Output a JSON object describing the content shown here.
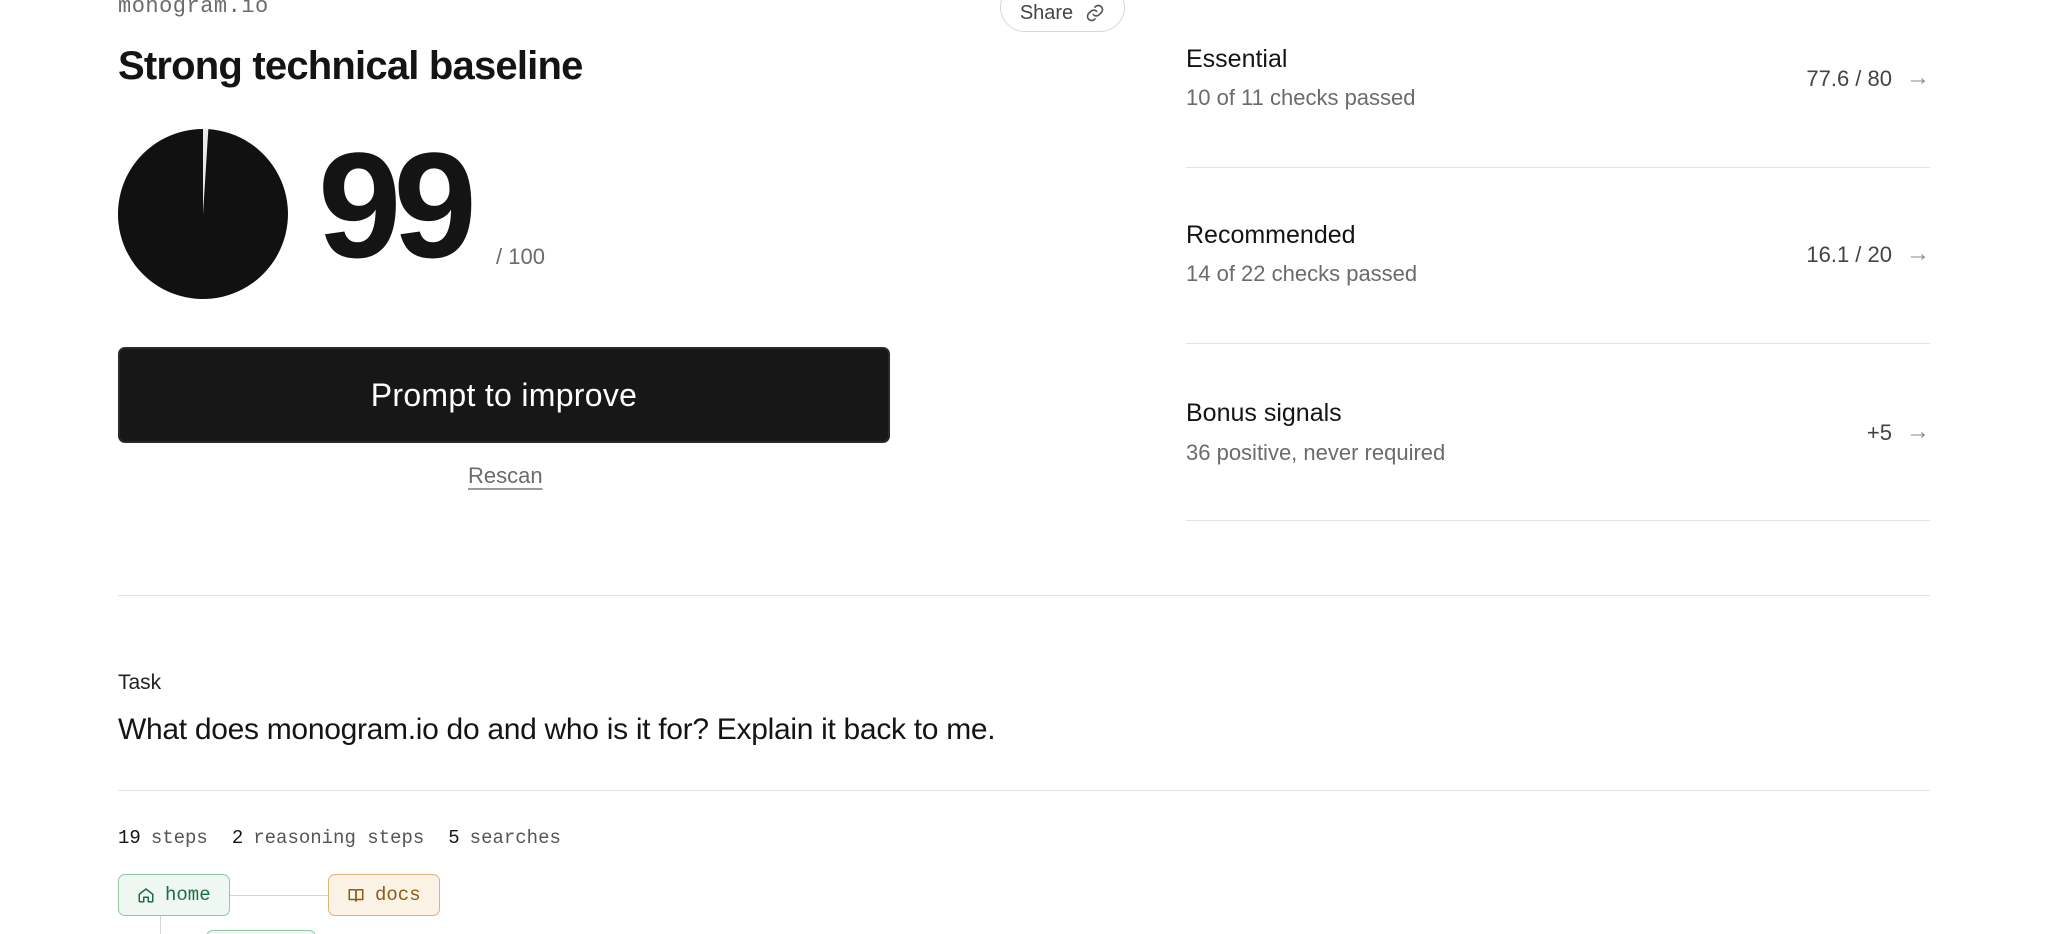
{
  "site": {
    "domain": "monogram.io"
  },
  "share": {
    "label": "Share",
    "icon": "link-icon"
  },
  "result": {
    "headline": "Strong technical baseline",
    "score": "99",
    "max": "/ 100",
    "score_fraction": 0.99
  },
  "actions": {
    "prompt_label": "Prompt to improve",
    "rescan_label": "Rescan"
  },
  "categories": [
    {
      "title": "Essential",
      "subtitle": "10 of 11 checks passed",
      "score": "77.6 / 80",
      "arrow": "→"
    },
    {
      "title": "Recommended",
      "subtitle": "14 of 22 checks passed",
      "score": "16.1 / 20",
      "arrow": "→"
    },
    {
      "title": "Bonus signals",
      "subtitle": "36 positive, never required",
      "score": "+5",
      "arrow": "→"
    }
  ],
  "task": {
    "label": "Task",
    "text": "What does monogram.io do and who is it for? Explain it back to me."
  },
  "stats": [
    {
      "count": "19",
      "label": "steps"
    },
    {
      "count": "2",
      "label": "reasoning steps"
    },
    {
      "count": "5",
      "label": "searches"
    }
  ],
  "graph": {
    "nodes": [
      {
        "label": "home",
        "icon": "home-icon",
        "color": "#1f6b45"
      },
      {
        "label": "docs",
        "icon": "book-icon",
        "color": "#8a5a17"
      }
    ]
  },
  "colors": {
    "primary_button": "#171717",
    "text": "#141414",
    "muted": "#6b6b6b",
    "divider": "#e2e2e2"
  }
}
